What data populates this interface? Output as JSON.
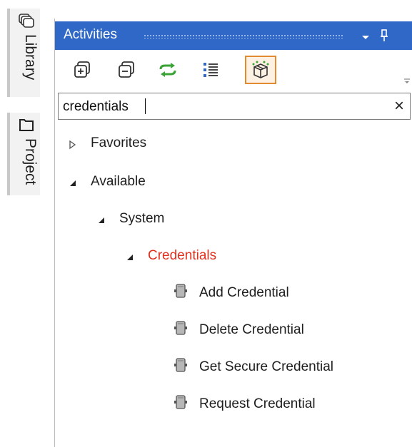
{
  "side_tabs": [
    {
      "label": "Library",
      "icon": "library-icon"
    },
    {
      "label": "Project",
      "icon": "project-icon"
    }
  ],
  "panel": {
    "title": "Activities",
    "toolbar": [
      {
        "name": "expand-all",
        "icon": "expand-all-icon"
      },
      {
        "name": "collapse-all",
        "icon": "collapse-all-icon"
      },
      {
        "name": "refresh",
        "icon": "refresh-icon"
      },
      {
        "name": "show-list",
        "icon": "list-icon"
      },
      {
        "name": "available-activities",
        "icon": "package-icon",
        "active": true
      }
    ],
    "search": {
      "value": "credentials",
      "clear_glyph": "×"
    }
  },
  "tree": {
    "favorites": "Favorites",
    "available": "Available",
    "system": "System",
    "credentials": "Credentials",
    "activities": [
      "Add Credential",
      "Delete Credential",
      "Get Secure Credential",
      "Request Credential"
    ]
  },
  "colors": {
    "title_bar": "#2f68c6",
    "highlight_node": "#e0321e",
    "active_button_border": "#e18a30",
    "refresh_icon": "#3aa335"
  }
}
